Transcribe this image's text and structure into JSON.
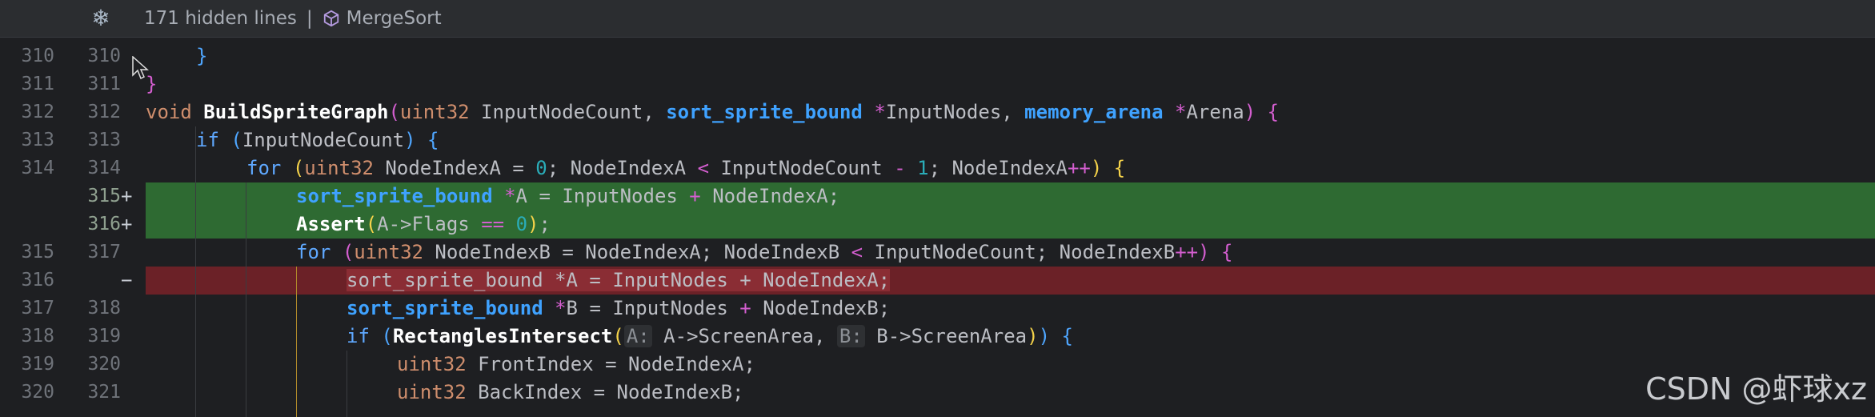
{
  "fold": {
    "hidden_lines": "171 hidden lines",
    "separator": "|",
    "crumb": "MergeSort"
  },
  "lines": [
    {
      "old": "310",
      "new": "310",
      "mark": "",
      "type": "normal"
    },
    {
      "old": "311",
      "new": "311",
      "mark": "",
      "type": "normal"
    },
    {
      "old": "312",
      "new": "312",
      "mark": "",
      "type": "normal"
    },
    {
      "old": "313",
      "new": "313",
      "mark": "",
      "type": "normal"
    },
    {
      "old": "314",
      "new": "314",
      "mark": "",
      "type": "normal"
    },
    {
      "old": "",
      "new": "315",
      "mark": "+",
      "type": "added"
    },
    {
      "old": "",
      "new": "316",
      "mark": "+",
      "type": "added"
    },
    {
      "old": "315",
      "new": "317",
      "mark": "",
      "type": "normal"
    },
    {
      "old": "316",
      "new": "",
      "mark": "−",
      "type": "removed"
    },
    {
      "old": "317",
      "new": "318",
      "mark": "",
      "type": "normal"
    },
    {
      "old": "318",
      "new": "319",
      "mark": "",
      "type": "normal"
    },
    {
      "old": "319",
      "new": "320",
      "mark": "",
      "type": "normal"
    },
    {
      "old": "320",
      "new": "321",
      "mark": "",
      "type": "normal"
    }
  ],
  "code": {
    "l0": {
      "brace": "}"
    },
    "l1": {
      "brace": "}"
    },
    "l2": {
      "void": "void",
      "fn": "BuildSpriteGraph",
      "p1": "(",
      "t1": "uint32",
      "a1": " InputNodeCount, ",
      "t2": "sort_sprite_bound",
      "star1": " *",
      "a2": "InputNodes, ",
      "t3": "memory_arena",
      "star2": " *",
      "a3": "Arena",
      "p2": ")",
      "sp": " ",
      "b": "{"
    },
    "l3": {
      "kw": "if",
      "sp": " ",
      "p1": "(",
      "a": "InputNodeCount",
      "p2": ")",
      "sp2": " ",
      "b": "{"
    },
    "l4": {
      "kw": "for",
      "sp": " ",
      "p1": "(",
      "t": "uint32",
      "a": " NodeIndexA = ",
      "n0": "0",
      "a2": "; NodeIndexA ",
      "lt": "<",
      "a3": " InputNodeCount ",
      "mi": "-",
      "sp2": " ",
      "n1": "1",
      "a4": "; NodeIndexA",
      "pp": "++",
      "p2": ")",
      "sp3": " ",
      "b": "{"
    },
    "l5": {
      "t": "sort_sprite_bound",
      "star": " *",
      "a": "A = InputNodes ",
      "plus": "+",
      "a2": " NodeIndexA;"
    },
    "l6": {
      "fn": "Assert",
      "p1": "(",
      "a": "A->Flags ",
      "eq": "==",
      "sp": " ",
      "n": "0",
      "p2": ")",
      "semi": ";"
    },
    "l7": {
      "kw": "for",
      "sp": " ",
      "p1": "(",
      "t": "uint32",
      "a": " NodeIndexB = NodeIndexA; NodeIndexB ",
      "lt": "<",
      "a2": " InputNodeCount; NodeIndexB",
      "pp": "++",
      "p2": ")",
      "sp2": " ",
      "b": "{"
    },
    "l8": {
      "text": "sort_sprite_bound *A = InputNodes + NodeIndexA;"
    },
    "l9": {
      "t": "sort_sprite_bound",
      "star": " *",
      "a": "B = InputNodes ",
      "plus": "+",
      "a2": " NodeIndexB;"
    },
    "l10": {
      "kw": "if",
      "sp": " ",
      "p1": "(",
      "fn": "RectanglesIntersect",
      "p2": "(",
      "h1": "A:",
      "a": " A->ScreenArea, ",
      "h2": "B:",
      "a2": " B->ScreenArea",
      "p3": ")",
      "p4": ")",
      "sp2": " ",
      "b": "{"
    },
    "l11": {
      "t": "uint32",
      "a": " FrontIndex = NodeIndexA;"
    },
    "l12": {
      "t": "uint32",
      "a": " BackIndex = NodeIndexB;"
    }
  },
  "watermark": "CSDN @虾球xz",
  "colors": {
    "added": "#2e6a32",
    "removed": "#6b2127",
    "background": "#1e1f22"
  }
}
